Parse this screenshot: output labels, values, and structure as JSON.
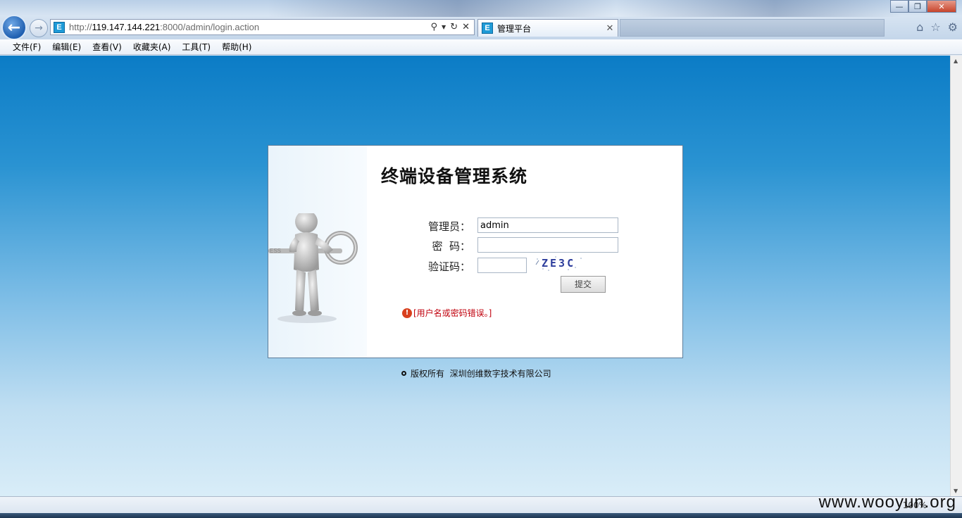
{
  "browser": {
    "url_prefix": "http://",
    "url_host": "119.147.144.221",
    "url_rest": ":8000/admin/login.action",
    "tab_title": "管理平台",
    "site_icon_letter": "E",
    "search_icon": "search-icon",
    "refresh_icon": "refresh-icon",
    "stop_icon": "stop-icon",
    "zoom_level": "100%"
  },
  "menu": {
    "items": [
      "文件(F)",
      "编辑(E)",
      "查看(V)",
      "收藏夹(A)",
      "工具(T)",
      "帮助(H)"
    ]
  },
  "login": {
    "system_title": "终端设备管理系统",
    "admin_label": "管理员：",
    "admin_value": "admin",
    "password_label": "密  码：",
    "password_value": "",
    "captcha_label": "验证码：",
    "captcha_value": "",
    "captcha_text": "ZE3C",
    "submit_label": "提交",
    "error_message": "[用户名或密码错误。]",
    "figure_text": "ESS"
  },
  "footer": {
    "copyright": "版权所有  深圳创维数字技术有限公司"
  },
  "watermark": "www.wooyun.org",
  "colors": {
    "page_top": "#0b7cc6",
    "page_bottom": "#d9edf8",
    "error": "#c0000c"
  }
}
